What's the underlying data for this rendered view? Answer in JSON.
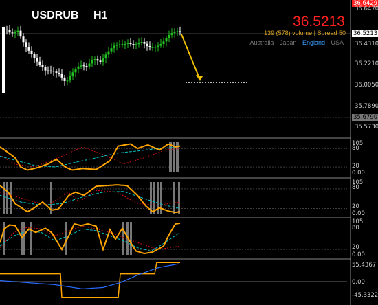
{
  "header": {
    "symbol": "USDRUB",
    "timeframe": "H1",
    "current_price": "36.5213",
    "volume_spread": "139 (578) volume | Spread 50",
    "sessions": [
      "Australia",
      "Japan",
      "England",
      "USA"
    ],
    "active_session": "England"
  },
  "price_axis": {
    "labels": [
      "36.6470",
      "36.5213",
      "36.4310",
      "36.2210",
      "36.0050",
      "35.7890",
      "35.6790",
      "35.5730"
    ],
    "top_box": "36.6429",
    "current_box": "36.5213",
    "line_box": "35.6790"
  },
  "indicator1_axis": [
    "105",
    "80",
    "20",
    "0.00"
  ],
  "indicator2_axis": [
    "105",
    "80",
    "20",
    "0.00"
  ],
  "indicator3_axis": [
    "105",
    "80",
    "20",
    "0.00"
  ],
  "indicator4_axis": [
    "55.4367",
    "0.00",
    "-45.3322"
  ],
  "colors": {
    "bull_candle": "#22c222",
    "bear_candle": "#ffffff",
    "price_text": "#ff2020",
    "signal_arrow": "#f0c000",
    "osc_line": "#ffa500",
    "osc_fast": "#00c8c8",
    "osc_dashed": "#cc1111",
    "grid": "#3a3a3a"
  },
  "icons": [
    "signal-arrow-icon"
  ]
}
